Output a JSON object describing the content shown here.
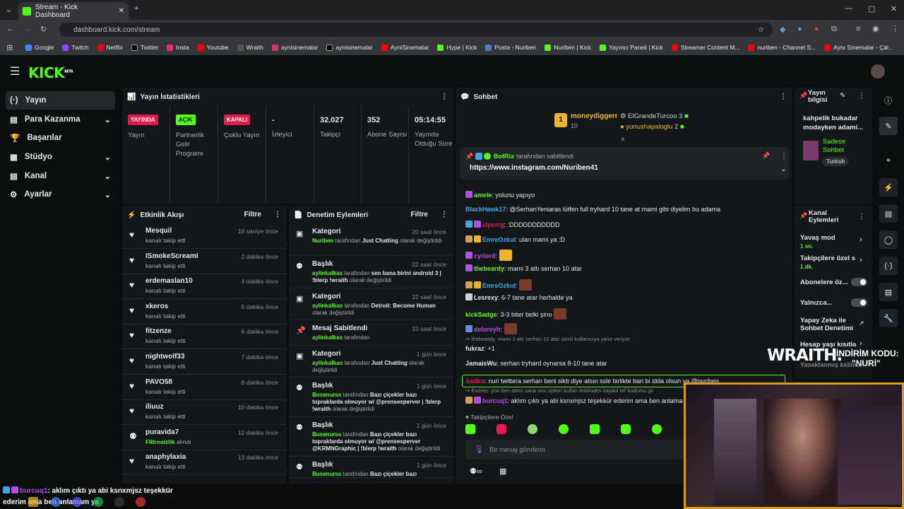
{
  "browser": {
    "tab_title": "Stream - Kick Dashboard",
    "url": "dashboard.kick.com/stream",
    "bookmarks": [
      "Google",
      "Twitch",
      "Netflix",
      "Twitter",
      "Insta",
      "Youtube",
      "Wraith",
      "aynisinemalar",
      "aynisinemalar",
      "AyniSinemalar",
      "Hype | Kick",
      "Posta - Nuriben",
      "Nuriben | Kick",
      "Yayıncı Paneli | Kick",
      "Streamer Content M...",
      "nuriben - Channel S...",
      "Aynı Sinemalar - Ça..."
    ]
  },
  "header": {
    "logo": "KICK",
    "logo_sup": "BETA"
  },
  "sidebar": {
    "items": [
      {
        "label": "Yayın",
        "icon": "(·)"
      },
      {
        "label": "Para Kazanma",
        "icon": "▤"
      },
      {
        "label": "Başarılar",
        "icon": "🏆"
      },
      {
        "label": "Stüdyo",
        "icon": "▦"
      },
      {
        "label": "Kanal",
        "icon": "▤"
      },
      {
        "label": "Ayarlar",
        "icon": "⚙"
      }
    ]
  },
  "stats": {
    "title": "Yayın İstatistikleri",
    "badge1": "YAYINDA",
    "label1": "Yayın",
    "badge2": "AÇIK",
    "label2": "Partnerlik Gelir Programı",
    "badge3": "KAPALI",
    "label3": "Çoklu Yayın",
    "val4": "-",
    "label4": "İzleyici",
    "val5": "32.027",
    "label5": "Takipçi",
    "val6": "352",
    "label6": "Abone Sayısı",
    "val7": "05:14:55",
    "label7": "Yayında Olduğu Süre"
  },
  "activity": {
    "title": "Etkinlik Akışı",
    "filter": "Filtre",
    "items": [
      {
        "name": "Mesquil",
        "sub": "kanalı takip etti",
        "time": "18 saniye önce"
      },
      {
        "name": "ISmokeScreamI",
        "sub": "kanalı takip etti",
        "time": "2 dakika önce"
      },
      {
        "name": "erdemaslan10",
        "sub": "kanalı takip etti",
        "time": "4 dakika önce"
      },
      {
        "name": "xkeros",
        "sub": "kanalı takip etti",
        "time": "5 dakika önce"
      },
      {
        "name": "fitzenze",
        "sub": "kanalı takip etti",
        "time": "6 dakika önce"
      },
      {
        "name": "nightwolf33",
        "sub": "kanalı takip etti",
        "time": "7 dakika önce"
      },
      {
        "name": "PAVO58",
        "sub": "kanalı takip etti",
        "time": "8 dakika önce"
      },
      {
        "name": "iliuuz",
        "sub": "kanalı takip etti",
        "time": "10 dakika önce"
      },
      {
        "name": "puravida7",
        "sub_green": "Filtresizlik",
        "sub": "alındı",
        "time": "12 dakika önce"
      },
      {
        "name": "anaphylaxia",
        "sub": "kanalı takip etti",
        "time": "13 dakika önce"
      }
    ]
  },
  "moderation": {
    "title": "Denetim Eylemleri",
    "filter": "Filtre",
    "items": [
      {
        "name": "Kategori",
        "time": "20 saat önce",
        "u": "Nuriben",
        "mid": "tarafından",
        "v": "Just Chatting",
        "end": "olarak değiştirildi"
      },
      {
        "name": "Başlık",
        "time": "22 saat önce",
        "u": "aylinkafkas",
        "mid": "tarafından",
        "v": "sen bana birini android 3 | !blerp !wraith",
        "end": "olarak değiştirildi"
      },
      {
        "name": "Kategori",
        "time": "22 saat önce",
        "u": "aylinkafkas",
        "mid": "tarafından",
        "v": "Detroit: Become Human",
        "end": "olarak değiştirildi"
      },
      {
        "name": "Mesaj Sabitlendi",
        "time": "23 saat önce",
        "u": "aylinkafkas",
        "mid": "tarafından",
        "v": "",
        "end": ""
      },
      {
        "name": "Kategori",
        "time": "1 gün önce",
        "u": "aylinkafkas",
        "mid": "tarafından",
        "v": "Just Chatting",
        "end": "olarak değiştirildi"
      },
      {
        "name": "Başlık",
        "time": "1 gün önce",
        "u": "Busenurss",
        "mid": "tarafından",
        "v": "Bazı çiçekler bazı topraklarda olmuyor w/ @prensesperver | !blerp !wraith",
        "end": "olarak değiştirildi"
      },
      {
        "name": "Başlık",
        "time": "1 gün önce",
        "u": "Busenurss",
        "mid": "tarafından",
        "v": "Bazı çiçekler bazı topraklarda olmuyor w/ @prensesperver @KRMNGraphic | !blerp !wraith",
        "end": "olarak değiştirildi"
      },
      {
        "name": "Başlık",
        "time": "1 gün önce",
        "u": "Busenurss",
        "mid": "tarafından",
        "v": "Bazı çiçekler bazı",
        "end": ""
      }
    ]
  },
  "chat": {
    "title": "Sohbet",
    "top_gifter": "moneydiggerr",
    "top_gifter_count": "10",
    "gifter2": "ElGrandeTurcoo",
    "gifter2_count": "3",
    "gifter3": "yunushayaloglu",
    "gifter3_count": "2",
    "pinned_by": "BotRix",
    "pinned_by_suffix": "tarafından sabitlendi",
    "pinned_link": "https://www.instagram.com/Nuriben41",
    "messages": [
      {
        "user": "amele",
        "text": ": yolunu yapıyo"
      },
      {
        "user": "BlackHawk17",
        "text": ": @SerhanYeniaras lütfen full tryhard 10 tane at mami gibi diyelim bu adama"
      },
      {
        "user": "alperrg",
        "text": ": :DDDDDDDDDDD"
      },
      {
        "user": "EmreOzkul",
        "text": ": ulan mami ya :D"
      },
      {
        "user": "cyrlord",
        "text": ":"
      },
      {
        "user": "thebeardy",
        "text": ": mami 3 attı serhan 10 atar"
      },
      {
        "user": "EmreOzkul",
        "text": ":"
      },
      {
        "user": "Lesrexy",
        "text": ": 6-7 tane atar herhalde ya"
      },
      {
        "user": "kickSadge",
        "text": ": 3-3 biter belki şino"
      },
      {
        "user": "deloreyh",
        "text": ":"
      },
      {
        "user": "fukraz",
        "text": ": +1",
        "reply": "thebeardy: mami 3 attı serhan 10 atar isimli kullanıcıya yanıt veriyor"
      },
      {
        "user": "JamaisWu",
        "text": ": serhan tryhard oynarsa 8-10 tane atar"
      },
      {
        "user": "kadira",
        "text": ": nuri twittera serhan beni sikti diye atsın ssle birlikte bari bi idda olsun ya @nuriben"
      },
      {
        "user": "burcuq1",
        "text": ": aklım çıktı ya abi ksnxmjsz teşekkür ederim ama ben anlamam ya",
        "reply": "Euores: yoo ben attım sana onu option kullan linkimden kaydol ref kodumu gir"
      }
    ],
    "followers_only": "Takipçilere Özel",
    "input_placeholder": "Bir mesaj gönderin"
  },
  "stream_info": {
    "title": "Yayın bilgisi",
    "stream_title": "kahpelik bukadar modayken adami...",
    "category": "Sadece Sohbet",
    "language": "Turkish"
  },
  "channel_actions": {
    "title": "Kanal Eylemleri",
    "slow": "Yavaş mod",
    "slow_val": "1 sn.",
    "followers": "Takipçilere özel s",
    "followers_val": "1 dk.",
    "subs": "Abonelere öz...",
    "emotes": "Yalnızca...",
    "ai": "Yapay Zeka ile Sohbet Denetimi",
    "age": "Hesap yaşı kısıtla",
    "restricted": "Yasaklanmış kelim..."
  },
  "overlay": {
    "brand": "WRAITH.",
    "promo_label": "İNDİRİM KODU:",
    "promo_code": "\"NURİ\"",
    "bottom_user": "burcuq1",
    "bottom_text": ": aklım çıktı ya abi ksnxmjsz teşekkür",
    "bottom_text2": "ederim ama ben anlamam ya"
  },
  "colors": {
    "kick_green": "#53fc18",
    "live_red": "#e5194d",
    "panel_bg": "#14171a",
    "cam_border": "#d89a20"
  }
}
